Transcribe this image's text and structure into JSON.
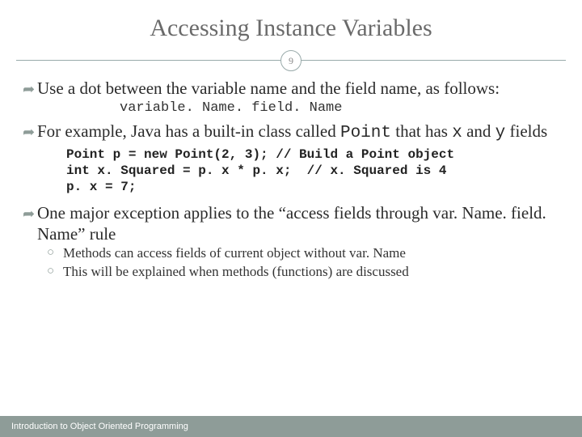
{
  "title": "Accessing Instance Variables",
  "page_number": "9",
  "bullets": [
    {
      "text_parts": [
        {
          "t": "Use a dot between the variable name and the field name, as follows:",
          "code": false
        }
      ],
      "snippet": "variable. Name. field. Name"
    },
    {
      "text_parts": [
        {
          "t": "For example, Java has a built-in class called ",
          "code": false
        },
        {
          "t": "Point",
          "code": true
        },
        {
          "t": " that has ",
          "code": false
        },
        {
          "t": "x",
          "code": true
        },
        {
          "t": " and ",
          "code": false
        },
        {
          "t": "y",
          "code": true
        },
        {
          "t": " fields",
          "code": false
        }
      ],
      "codeblock": "Point p = new Point(2, 3); // Build a Point object\nint x. Squared = p. x * p. x;  // x. Squared is 4\np. x = 7;"
    },
    {
      "text_parts": [
        {
          "t": "One major exception applies to the “access fields through var. Name. field. Name” rule",
          "code": false
        }
      ],
      "subs": [
        "Methods can access fields of current object without var. Name",
        "This will be explained when methods (functions) are discussed"
      ]
    }
  ],
  "footer": "Introduction to Object Oriented Programming"
}
